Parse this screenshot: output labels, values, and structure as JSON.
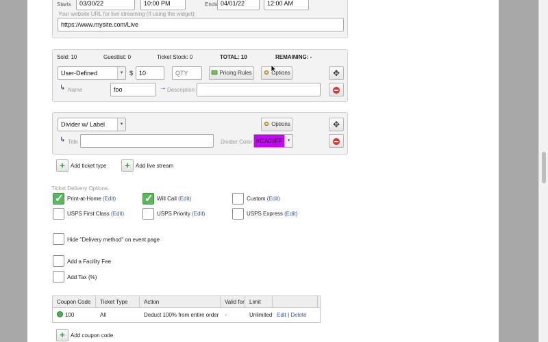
{
  "top": {
    "starts_label": "Starts",
    "start_date": "03/30/22",
    "start_time": "10:00 PM",
    "ends_label": "Ends",
    "end_date": "04/01/22",
    "end_time": "12:00 AM",
    "stream_url_label": "Your website URL for live streaming (If using the widget):",
    "stream_url_value": "https://www.mysite.com/Live"
  },
  "ticket_panel": {
    "sold": "Sold: 10",
    "guestlist": "Guestlist: 0",
    "ticket_stock": "Ticket Stock: 0",
    "total": "TOTAL: 10",
    "remaining": "REMAINING: -",
    "type_selected": "User-Defined",
    "currency": "$",
    "price": "10",
    "qty_placeholder": "QTY",
    "pricing_rules": "Pricing Rules",
    "options": "Options",
    "name_label": "Name",
    "name_value": "foo",
    "description_label": "Description",
    "description_value": ""
  },
  "divider_panel": {
    "type_selected": "Divider w/ Label",
    "options": "Options",
    "title_label": "Title",
    "title_value": "",
    "divider_color_label": "Divider Color",
    "divider_color_value": "#CA00FF",
    "color": "#ca00ff"
  },
  "actions": {
    "add_ticket_type": "Add ticket type",
    "add_live_stream": "Add live stream"
  },
  "delivery": {
    "heading": "Ticket Delivery Options:",
    "edit": "(Edit)",
    "options": [
      {
        "label": "Print-at-Home",
        "checked": true
      },
      {
        "label": "Will Call",
        "checked": true
      },
      {
        "label": "Custom",
        "checked": false
      },
      {
        "label": "USPS First Class",
        "checked": false
      },
      {
        "label": "USPS Priority",
        "checked": false
      },
      {
        "label": "USPS Express",
        "checked": false
      }
    ]
  },
  "extras": {
    "hide_delivery": "Hide \"Delivery method\" on event page",
    "facility_fee": "Add a Facility Fee",
    "add_tax": "Add Tax (%)"
  },
  "coupons": {
    "columns": [
      "Coupon Code",
      "Ticket Type",
      "Action",
      "Valid for",
      "Limit"
    ],
    "rows": [
      {
        "code": "100",
        "ticket_type": "All",
        "action": "Deduct 100% from entire order",
        "valid_for": "-",
        "limit": "Unlimited",
        "edit": "Edit",
        "sep": "|",
        "delete": "Delete"
      }
    ],
    "add_coupon": "Add coupon code"
  }
}
